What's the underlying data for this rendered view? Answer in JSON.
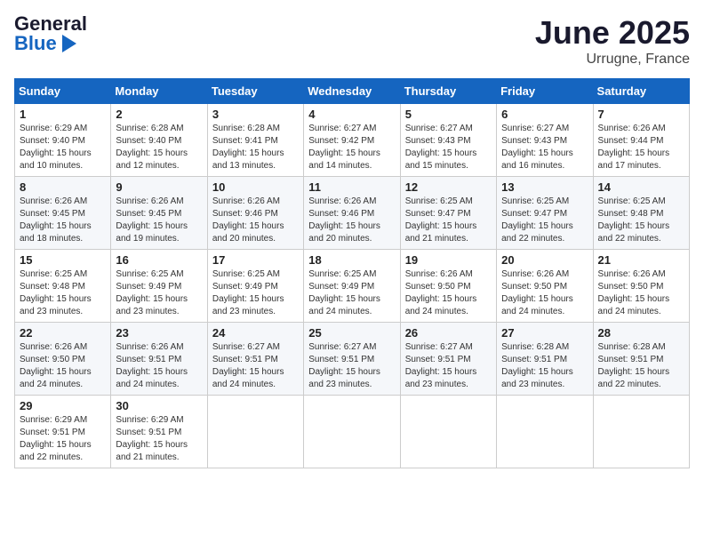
{
  "header": {
    "logo_general": "General",
    "logo_blue": "Blue",
    "month_title": "June 2025",
    "location": "Urrugne, France"
  },
  "weekdays": [
    "Sunday",
    "Monday",
    "Tuesday",
    "Wednesday",
    "Thursday",
    "Friday",
    "Saturday"
  ],
  "weeks": [
    [
      {
        "day": "1",
        "sunrise": "Sunrise: 6:29 AM",
        "sunset": "Sunset: 9:40 PM",
        "daylight": "Daylight: 15 hours and 10 minutes."
      },
      {
        "day": "2",
        "sunrise": "Sunrise: 6:28 AM",
        "sunset": "Sunset: 9:40 PM",
        "daylight": "Daylight: 15 hours and 12 minutes."
      },
      {
        "day": "3",
        "sunrise": "Sunrise: 6:28 AM",
        "sunset": "Sunset: 9:41 PM",
        "daylight": "Daylight: 15 hours and 13 minutes."
      },
      {
        "day": "4",
        "sunrise": "Sunrise: 6:27 AM",
        "sunset": "Sunset: 9:42 PM",
        "daylight": "Daylight: 15 hours and 14 minutes."
      },
      {
        "day": "5",
        "sunrise": "Sunrise: 6:27 AM",
        "sunset": "Sunset: 9:43 PM",
        "daylight": "Daylight: 15 hours and 15 minutes."
      },
      {
        "day": "6",
        "sunrise": "Sunrise: 6:27 AM",
        "sunset": "Sunset: 9:43 PM",
        "daylight": "Daylight: 15 hours and 16 minutes."
      },
      {
        "day": "7",
        "sunrise": "Sunrise: 6:26 AM",
        "sunset": "Sunset: 9:44 PM",
        "daylight": "Daylight: 15 hours and 17 minutes."
      }
    ],
    [
      {
        "day": "8",
        "sunrise": "Sunrise: 6:26 AM",
        "sunset": "Sunset: 9:45 PM",
        "daylight": "Daylight: 15 hours and 18 minutes."
      },
      {
        "day": "9",
        "sunrise": "Sunrise: 6:26 AM",
        "sunset": "Sunset: 9:45 PM",
        "daylight": "Daylight: 15 hours and 19 minutes."
      },
      {
        "day": "10",
        "sunrise": "Sunrise: 6:26 AM",
        "sunset": "Sunset: 9:46 PM",
        "daylight": "Daylight: 15 hours and 20 minutes."
      },
      {
        "day": "11",
        "sunrise": "Sunrise: 6:26 AM",
        "sunset": "Sunset: 9:46 PM",
        "daylight": "Daylight: 15 hours and 20 minutes."
      },
      {
        "day": "12",
        "sunrise": "Sunrise: 6:25 AM",
        "sunset": "Sunset: 9:47 PM",
        "daylight": "Daylight: 15 hours and 21 minutes."
      },
      {
        "day": "13",
        "sunrise": "Sunrise: 6:25 AM",
        "sunset": "Sunset: 9:47 PM",
        "daylight": "Daylight: 15 hours and 22 minutes."
      },
      {
        "day": "14",
        "sunrise": "Sunrise: 6:25 AM",
        "sunset": "Sunset: 9:48 PM",
        "daylight": "Daylight: 15 hours and 22 minutes."
      }
    ],
    [
      {
        "day": "15",
        "sunrise": "Sunrise: 6:25 AM",
        "sunset": "Sunset: 9:48 PM",
        "daylight": "Daylight: 15 hours and 23 minutes."
      },
      {
        "day": "16",
        "sunrise": "Sunrise: 6:25 AM",
        "sunset": "Sunset: 9:49 PM",
        "daylight": "Daylight: 15 hours and 23 minutes."
      },
      {
        "day": "17",
        "sunrise": "Sunrise: 6:25 AM",
        "sunset": "Sunset: 9:49 PM",
        "daylight": "Daylight: 15 hours and 23 minutes."
      },
      {
        "day": "18",
        "sunrise": "Sunrise: 6:25 AM",
        "sunset": "Sunset: 9:49 PM",
        "daylight": "Daylight: 15 hours and 24 minutes."
      },
      {
        "day": "19",
        "sunrise": "Sunrise: 6:26 AM",
        "sunset": "Sunset: 9:50 PM",
        "daylight": "Daylight: 15 hours and 24 minutes."
      },
      {
        "day": "20",
        "sunrise": "Sunrise: 6:26 AM",
        "sunset": "Sunset: 9:50 PM",
        "daylight": "Daylight: 15 hours and 24 minutes."
      },
      {
        "day": "21",
        "sunrise": "Sunrise: 6:26 AM",
        "sunset": "Sunset: 9:50 PM",
        "daylight": "Daylight: 15 hours and 24 minutes."
      }
    ],
    [
      {
        "day": "22",
        "sunrise": "Sunrise: 6:26 AM",
        "sunset": "Sunset: 9:50 PM",
        "daylight": "Daylight: 15 hours and 24 minutes."
      },
      {
        "day": "23",
        "sunrise": "Sunrise: 6:26 AM",
        "sunset": "Sunset: 9:51 PM",
        "daylight": "Daylight: 15 hours and 24 minutes."
      },
      {
        "day": "24",
        "sunrise": "Sunrise: 6:27 AM",
        "sunset": "Sunset: 9:51 PM",
        "daylight": "Daylight: 15 hours and 24 minutes."
      },
      {
        "day": "25",
        "sunrise": "Sunrise: 6:27 AM",
        "sunset": "Sunset: 9:51 PM",
        "daylight": "Daylight: 15 hours and 23 minutes."
      },
      {
        "day": "26",
        "sunrise": "Sunrise: 6:27 AM",
        "sunset": "Sunset: 9:51 PM",
        "daylight": "Daylight: 15 hours and 23 minutes."
      },
      {
        "day": "27",
        "sunrise": "Sunrise: 6:28 AM",
        "sunset": "Sunset: 9:51 PM",
        "daylight": "Daylight: 15 hours and 23 minutes."
      },
      {
        "day": "28",
        "sunrise": "Sunrise: 6:28 AM",
        "sunset": "Sunset: 9:51 PM",
        "daylight": "Daylight: 15 hours and 22 minutes."
      }
    ],
    [
      {
        "day": "29",
        "sunrise": "Sunrise: 6:29 AM",
        "sunset": "Sunset: 9:51 PM",
        "daylight": "Daylight: 15 hours and 22 minutes."
      },
      {
        "day": "30",
        "sunrise": "Sunrise: 6:29 AM",
        "sunset": "Sunset: 9:51 PM",
        "daylight": "Daylight: 15 hours and 21 minutes."
      },
      null,
      null,
      null,
      null,
      null
    ]
  ]
}
